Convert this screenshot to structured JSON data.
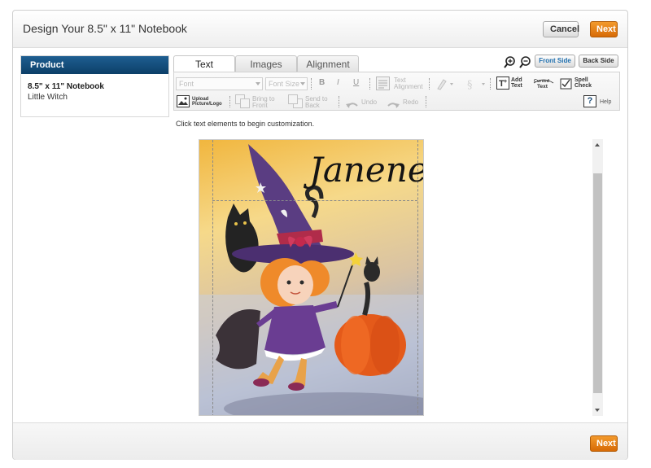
{
  "header": {
    "title": "Design Your 8.5\" x 11\" Notebook",
    "cancel_label": "Cancel",
    "next_label": "Next"
  },
  "product": {
    "heading": "Product",
    "name": "8.5\" x 11\" Notebook",
    "design": "Little Witch"
  },
  "tabs": [
    {
      "label": "Text"
    },
    {
      "label": "Images"
    },
    {
      "label": "Alignment"
    }
  ],
  "toolbar": {
    "font_placeholder": "Font",
    "font_size_placeholder": "Font Size",
    "bold": "B",
    "italic": "I",
    "underline": "U",
    "text_alignment": [
      "Text",
      "Alignment"
    ],
    "add_text": [
      "Add",
      "Text"
    ],
    "curved_text": [
      "Curved",
      "Text"
    ],
    "spell_check": [
      "Spell",
      "Check"
    ],
    "upload": [
      "Upload",
      "Picture/Logo"
    ],
    "bring_to_front": [
      "Bring to",
      "Front"
    ],
    "send_to_back": [
      "Send to",
      "Back"
    ],
    "undo": "Undo",
    "redo": "Redo",
    "help": "Help",
    "help_icon": "?",
    "front_side": "Front Side",
    "back_side": "Back Side"
  },
  "instructions": "Click text elements to begin customization.",
  "canvas": {
    "text": "Janene"
  },
  "footer": {
    "next_label": "Next"
  },
  "colors": {
    "orange": "#e07a12",
    "navy": "#0c3f68"
  },
  "icons": [
    "zoom-in-icon",
    "zoom-out-icon",
    "text-alignment-icon",
    "text-color-icon",
    "spacing-icon",
    "add-text-icon",
    "curved-text-icon",
    "spell-check-icon",
    "upload-image-icon",
    "bring-to-front-icon",
    "send-to-back-icon",
    "undo-icon",
    "redo-icon",
    "help-icon"
  ]
}
